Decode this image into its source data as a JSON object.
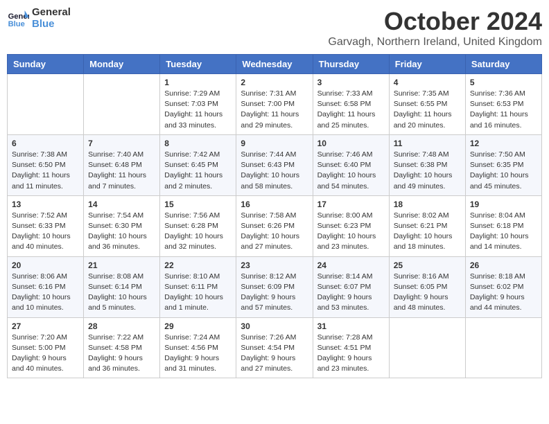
{
  "logo": {
    "line1": "General",
    "line2": "Blue"
  },
  "title": "October 2024",
  "location": "Garvagh, Northern Ireland, United Kingdom",
  "days_of_week": [
    "Sunday",
    "Monday",
    "Tuesday",
    "Wednesday",
    "Thursday",
    "Friday",
    "Saturday"
  ],
  "weeks": [
    [
      {
        "day": "",
        "info": ""
      },
      {
        "day": "",
        "info": ""
      },
      {
        "day": "1",
        "info": "Sunrise: 7:29 AM\nSunset: 7:03 PM\nDaylight: 11 hours and 33 minutes."
      },
      {
        "day": "2",
        "info": "Sunrise: 7:31 AM\nSunset: 7:00 PM\nDaylight: 11 hours and 29 minutes."
      },
      {
        "day": "3",
        "info": "Sunrise: 7:33 AM\nSunset: 6:58 PM\nDaylight: 11 hours and 25 minutes."
      },
      {
        "day": "4",
        "info": "Sunrise: 7:35 AM\nSunset: 6:55 PM\nDaylight: 11 hours and 20 minutes."
      },
      {
        "day": "5",
        "info": "Sunrise: 7:36 AM\nSunset: 6:53 PM\nDaylight: 11 hours and 16 minutes."
      }
    ],
    [
      {
        "day": "6",
        "info": "Sunrise: 7:38 AM\nSunset: 6:50 PM\nDaylight: 11 hours and 11 minutes."
      },
      {
        "day": "7",
        "info": "Sunrise: 7:40 AM\nSunset: 6:48 PM\nDaylight: 11 hours and 7 minutes."
      },
      {
        "day": "8",
        "info": "Sunrise: 7:42 AM\nSunset: 6:45 PM\nDaylight: 11 hours and 2 minutes."
      },
      {
        "day": "9",
        "info": "Sunrise: 7:44 AM\nSunset: 6:43 PM\nDaylight: 10 hours and 58 minutes."
      },
      {
        "day": "10",
        "info": "Sunrise: 7:46 AM\nSunset: 6:40 PM\nDaylight: 10 hours and 54 minutes."
      },
      {
        "day": "11",
        "info": "Sunrise: 7:48 AM\nSunset: 6:38 PM\nDaylight: 10 hours and 49 minutes."
      },
      {
        "day": "12",
        "info": "Sunrise: 7:50 AM\nSunset: 6:35 PM\nDaylight: 10 hours and 45 minutes."
      }
    ],
    [
      {
        "day": "13",
        "info": "Sunrise: 7:52 AM\nSunset: 6:33 PM\nDaylight: 10 hours and 40 minutes."
      },
      {
        "day": "14",
        "info": "Sunrise: 7:54 AM\nSunset: 6:30 PM\nDaylight: 10 hours and 36 minutes."
      },
      {
        "day": "15",
        "info": "Sunrise: 7:56 AM\nSunset: 6:28 PM\nDaylight: 10 hours and 32 minutes."
      },
      {
        "day": "16",
        "info": "Sunrise: 7:58 AM\nSunset: 6:26 PM\nDaylight: 10 hours and 27 minutes."
      },
      {
        "day": "17",
        "info": "Sunrise: 8:00 AM\nSunset: 6:23 PM\nDaylight: 10 hours and 23 minutes."
      },
      {
        "day": "18",
        "info": "Sunrise: 8:02 AM\nSunset: 6:21 PM\nDaylight: 10 hours and 18 minutes."
      },
      {
        "day": "19",
        "info": "Sunrise: 8:04 AM\nSunset: 6:18 PM\nDaylight: 10 hours and 14 minutes."
      }
    ],
    [
      {
        "day": "20",
        "info": "Sunrise: 8:06 AM\nSunset: 6:16 PM\nDaylight: 10 hours and 10 minutes."
      },
      {
        "day": "21",
        "info": "Sunrise: 8:08 AM\nSunset: 6:14 PM\nDaylight: 10 hours and 5 minutes."
      },
      {
        "day": "22",
        "info": "Sunrise: 8:10 AM\nSunset: 6:11 PM\nDaylight: 10 hours and 1 minute."
      },
      {
        "day": "23",
        "info": "Sunrise: 8:12 AM\nSunset: 6:09 PM\nDaylight: 9 hours and 57 minutes."
      },
      {
        "day": "24",
        "info": "Sunrise: 8:14 AM\nSunset: 6:07 PM\nDaylight: 9 hours and 53 minutes."
      },
      {
        "day": "25",
        "info": "Sunrise: 8:16 AM\nSunset: 6:05 PM\nDaylight: 9 hours and 48 minutes."
      },
      {
        "day": "26",
        "info": "Sunrise: 8:18 AM\nSunset: 6:02 PM\nDaylight: 9 hours and 44 minutes."
      }
    ],
    [
      {
        "day": "27",
        "info": "Sunrise: 7:20 AM\nSunset: 5:00 PM\nDaylight: 9 hours and 40 minutes."
      },
      {
        "day": "28",
        "info": "Sunrise: 7:22 AM\nSunset: 4:58 PM\nDaylight: 9 hours and 36 minutes."
      },
      {
        "day": "29",
        "info": "Sunrise: 7:24 AM\nSunset: 4:56 PM\nDaylight: 9 hours and 31 minutes."
      },
      {
        "day": "30",
        "info": "Sunrise: 7:26 AM\nSunset: 4:54 PM\nDaylight: 9 hours and 27 minutes."
      },
      {
        "day": "31",
        "info": "Sunrise: 7:28 AM\nSunset: 4:51 PM\nDaylight: 9 hours and 23 minutes."
      },
      {
        "day": "",
        "info": ""
      },
      {
        "day": "",
        "info": ""
      }
    ]
  ]
}
